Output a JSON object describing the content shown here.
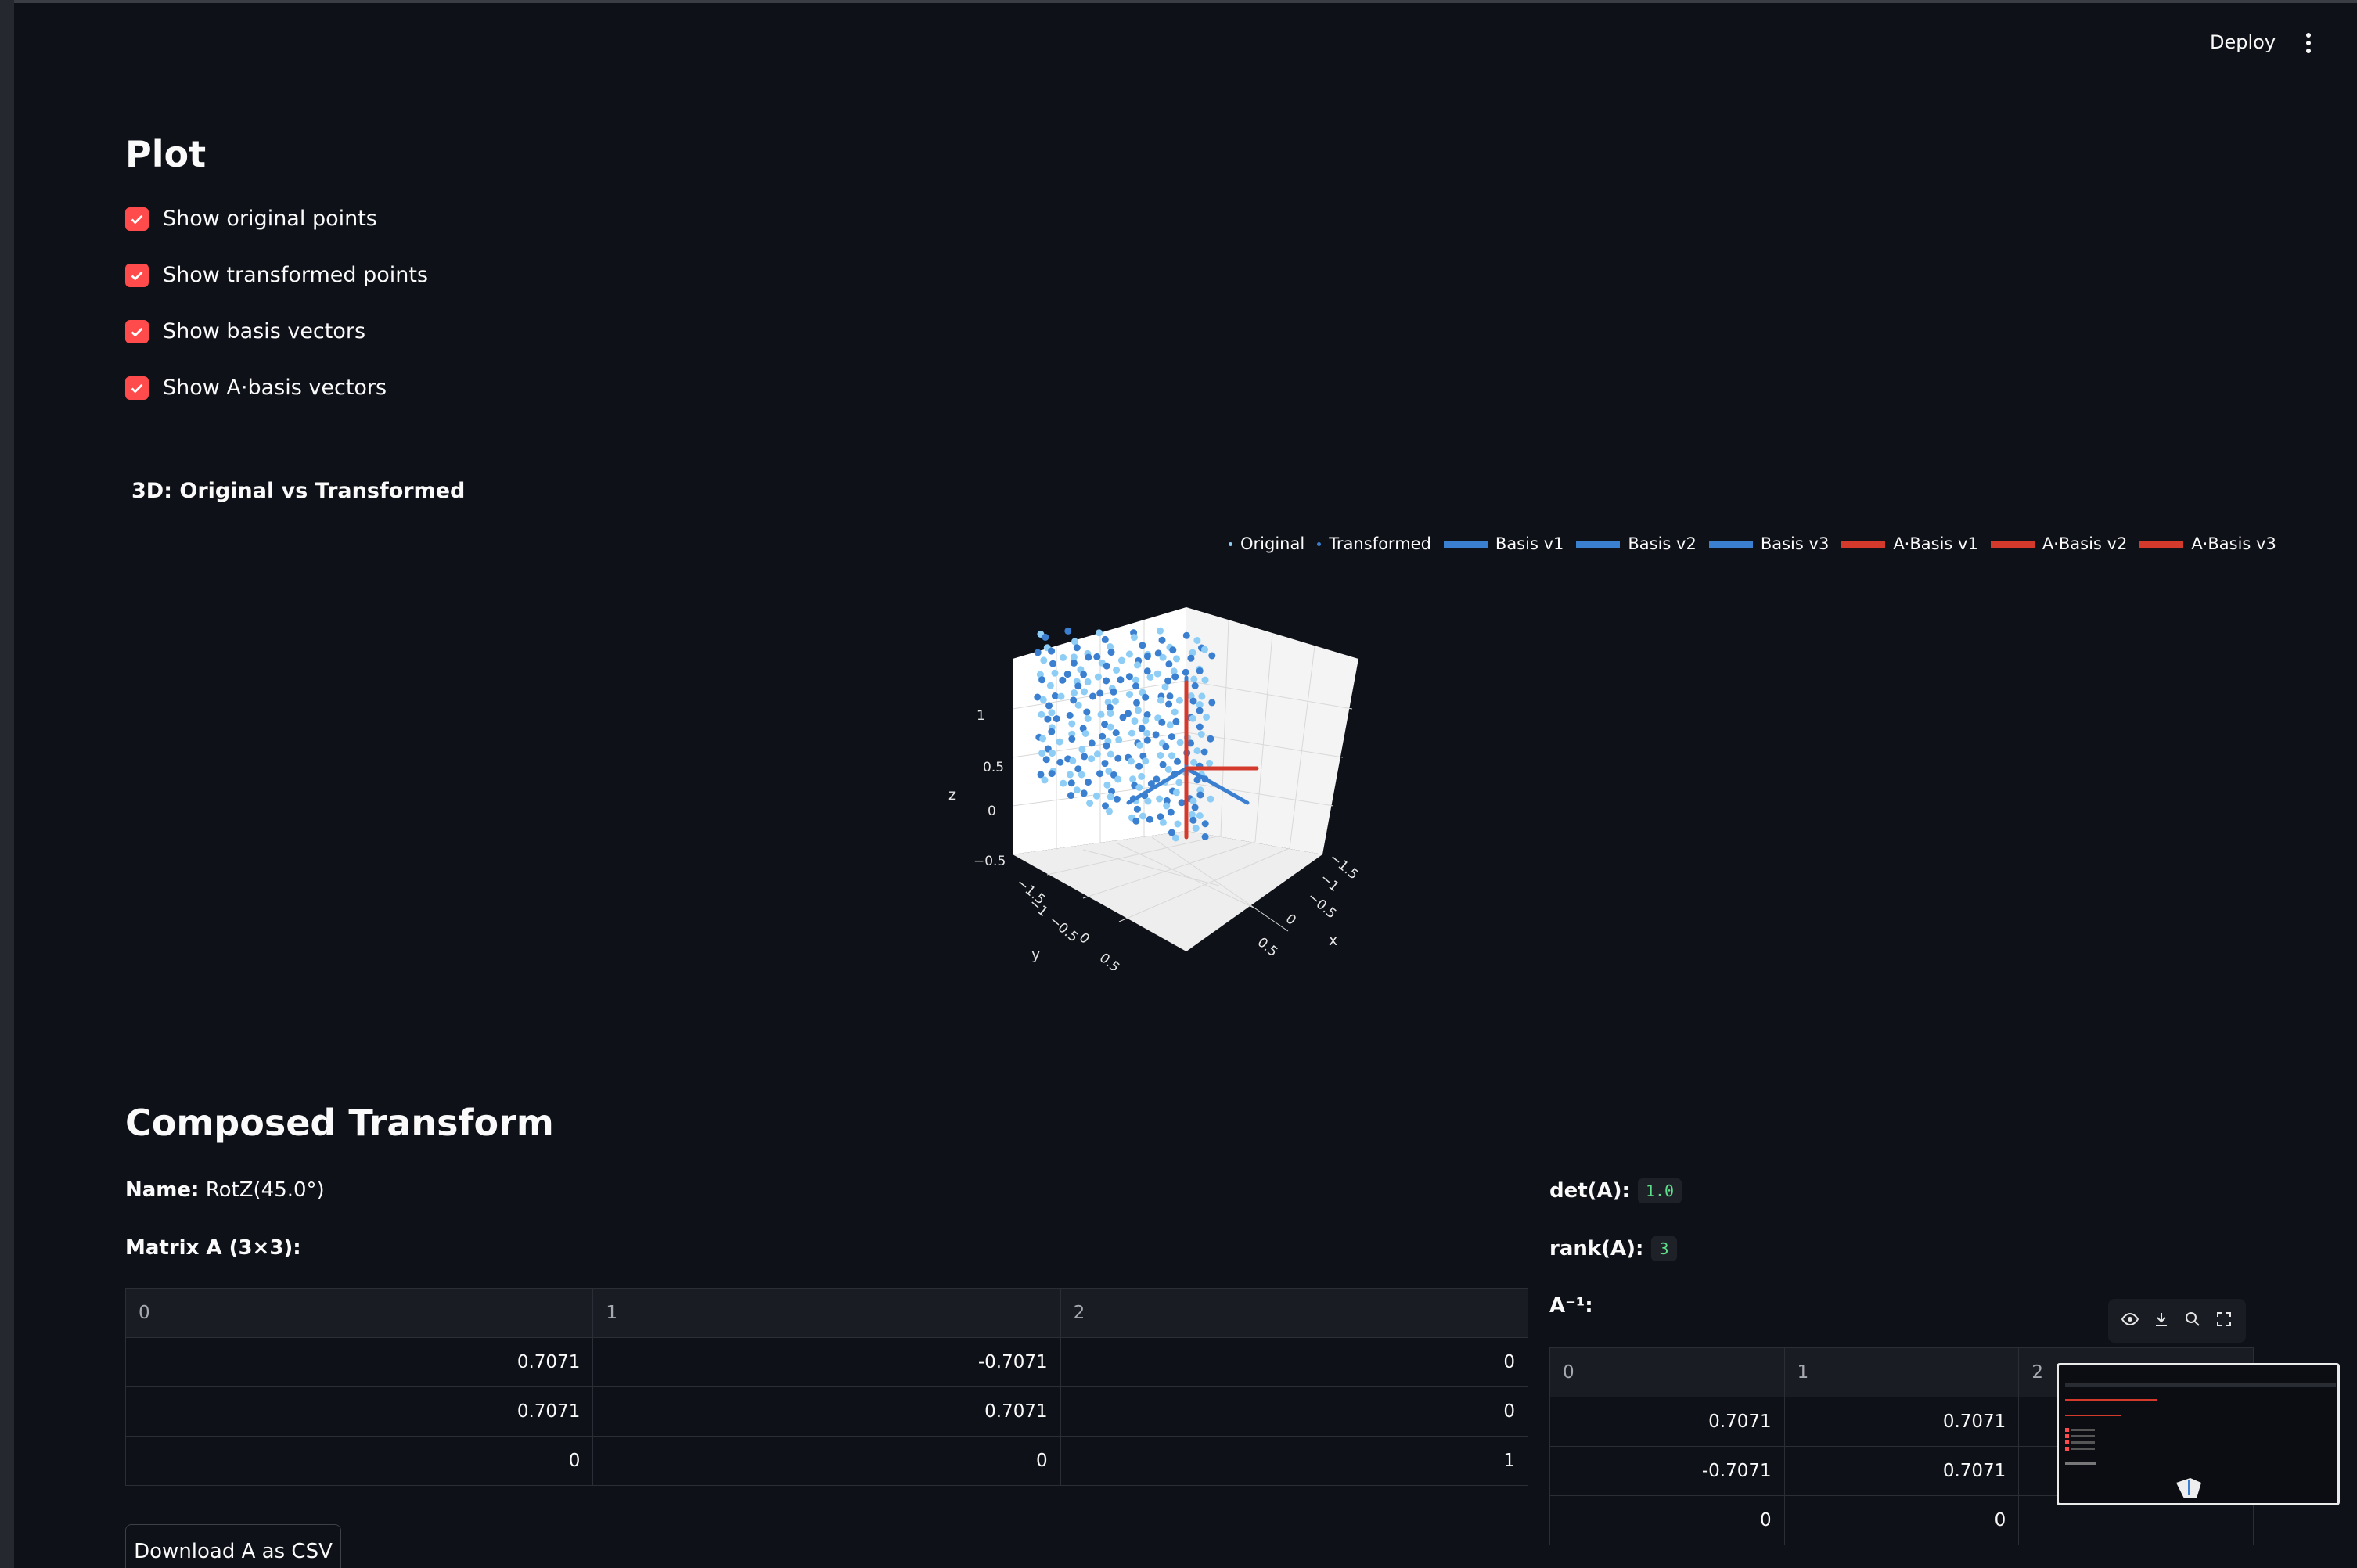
{
  "header": {
    "deploy_label": "Deploy"
  },
  "plot_section": {
    "title": "Plot",
    "checkboxes": [
      {
        "label": "Show original points",
        "checked": true
      },
      {
        "label": "Show transformed points",
        "checked": true
      },
      {
        "label": "Show basis vectors",
        "checked": true
      },
      {
        "label": "Show A·basis vectors",
        "checked": true
      }
    ],
    "chart_title": "3D: Original vs Transformed"
  },
  "chart_data": {
    "type": "scatter",
    "title": "3D: Original vs Transformed",
    "legend": [
      {
        "name": "Original",
        "kind": "marker",
        "color": "#8ecdf5"
      },
      {
        "name": "Transformed",
        "kind": "marker",
        "color": "#3a7fd0"
      },
      {
        "name": "Basis v1",
        "kind": "line",
        "color": "#3a7fd0"
      },
      {
        "name": "Basis v2",
        "kind": "line",
        "color": "#3a7fd0"
      },
      {
        "name": "Basis v3",
        "kind": "line",
        "color": "#3a7fd0"
      },
      {
        "name": "A·Basis v1",
        "kind": "line",
        "color": "#d33a2c"
      },
      {
        "name": "A·Basis v2",
        "kind": "line",
        "color": "#d33a2c"
      },
      {
        "name": "A·Basis v3",
        "kind": "line",
        "color": "#d33a2c"
      }
    ],
    "legend_position": "top-right",
    "axes": {
      "x": {
        "label": "x",
        "ticks": [
          "−1.5",
          "−1",
          "−0.5",
          "0",
          "0.5"
        ]
      },
      "y": {
        "label": "y",
        "ticks": [
          "−1.5",
          "−1",
          "−0.5",
          "0",
          "0.5"
        ]
      },
      "z": {
        "label": "z",
        "ticks": [
          "−0.5",
          "0",
          "0.5",
          "1"
        ]
      }
    },
    "grid": true
  },
  "composed": {
    "title": "Composed Transform",
    "name_label": "Name:",
    "name_value": "RotZ(45.0°)",
    "matrix_label": "Matrix A (3×3):",
    "matrix_headers": [
      "0",
      "1",
      "2"
    ],
    "matrix_rows": [
      [
        "0.7071",
        "-0.7071",
        "0"
      ],
      [
        "0.7071",
        "0.7071",
        "0"
      ],
      [
        "0",
        "0",
        "1"
      ]
    ],
    "download_label": "Download A as CSV",
    "det_label": "det(A):",
    "det_value": "1.0",
    "rank_label": "rank(A):",
    "rank_value": "3",
    "inverse_label": "A⁻¹:",
    "inverse_headers": [
      "0",
      "1",
      "2"
    ],
    "inverse_rows": [
      [
        "0.7071",
        "0.7071",
        ""
      ],
      [
        "-0.7071",
        "0.7071",
        ""
      ],
      [
        "0",
        "0",
        ""
      ]
    ]
  },
  "colors": {
    "accent": "#ff4b4b",
    "background": "#0e1117",
    "code_green": "#5ee08b"
  }
}
